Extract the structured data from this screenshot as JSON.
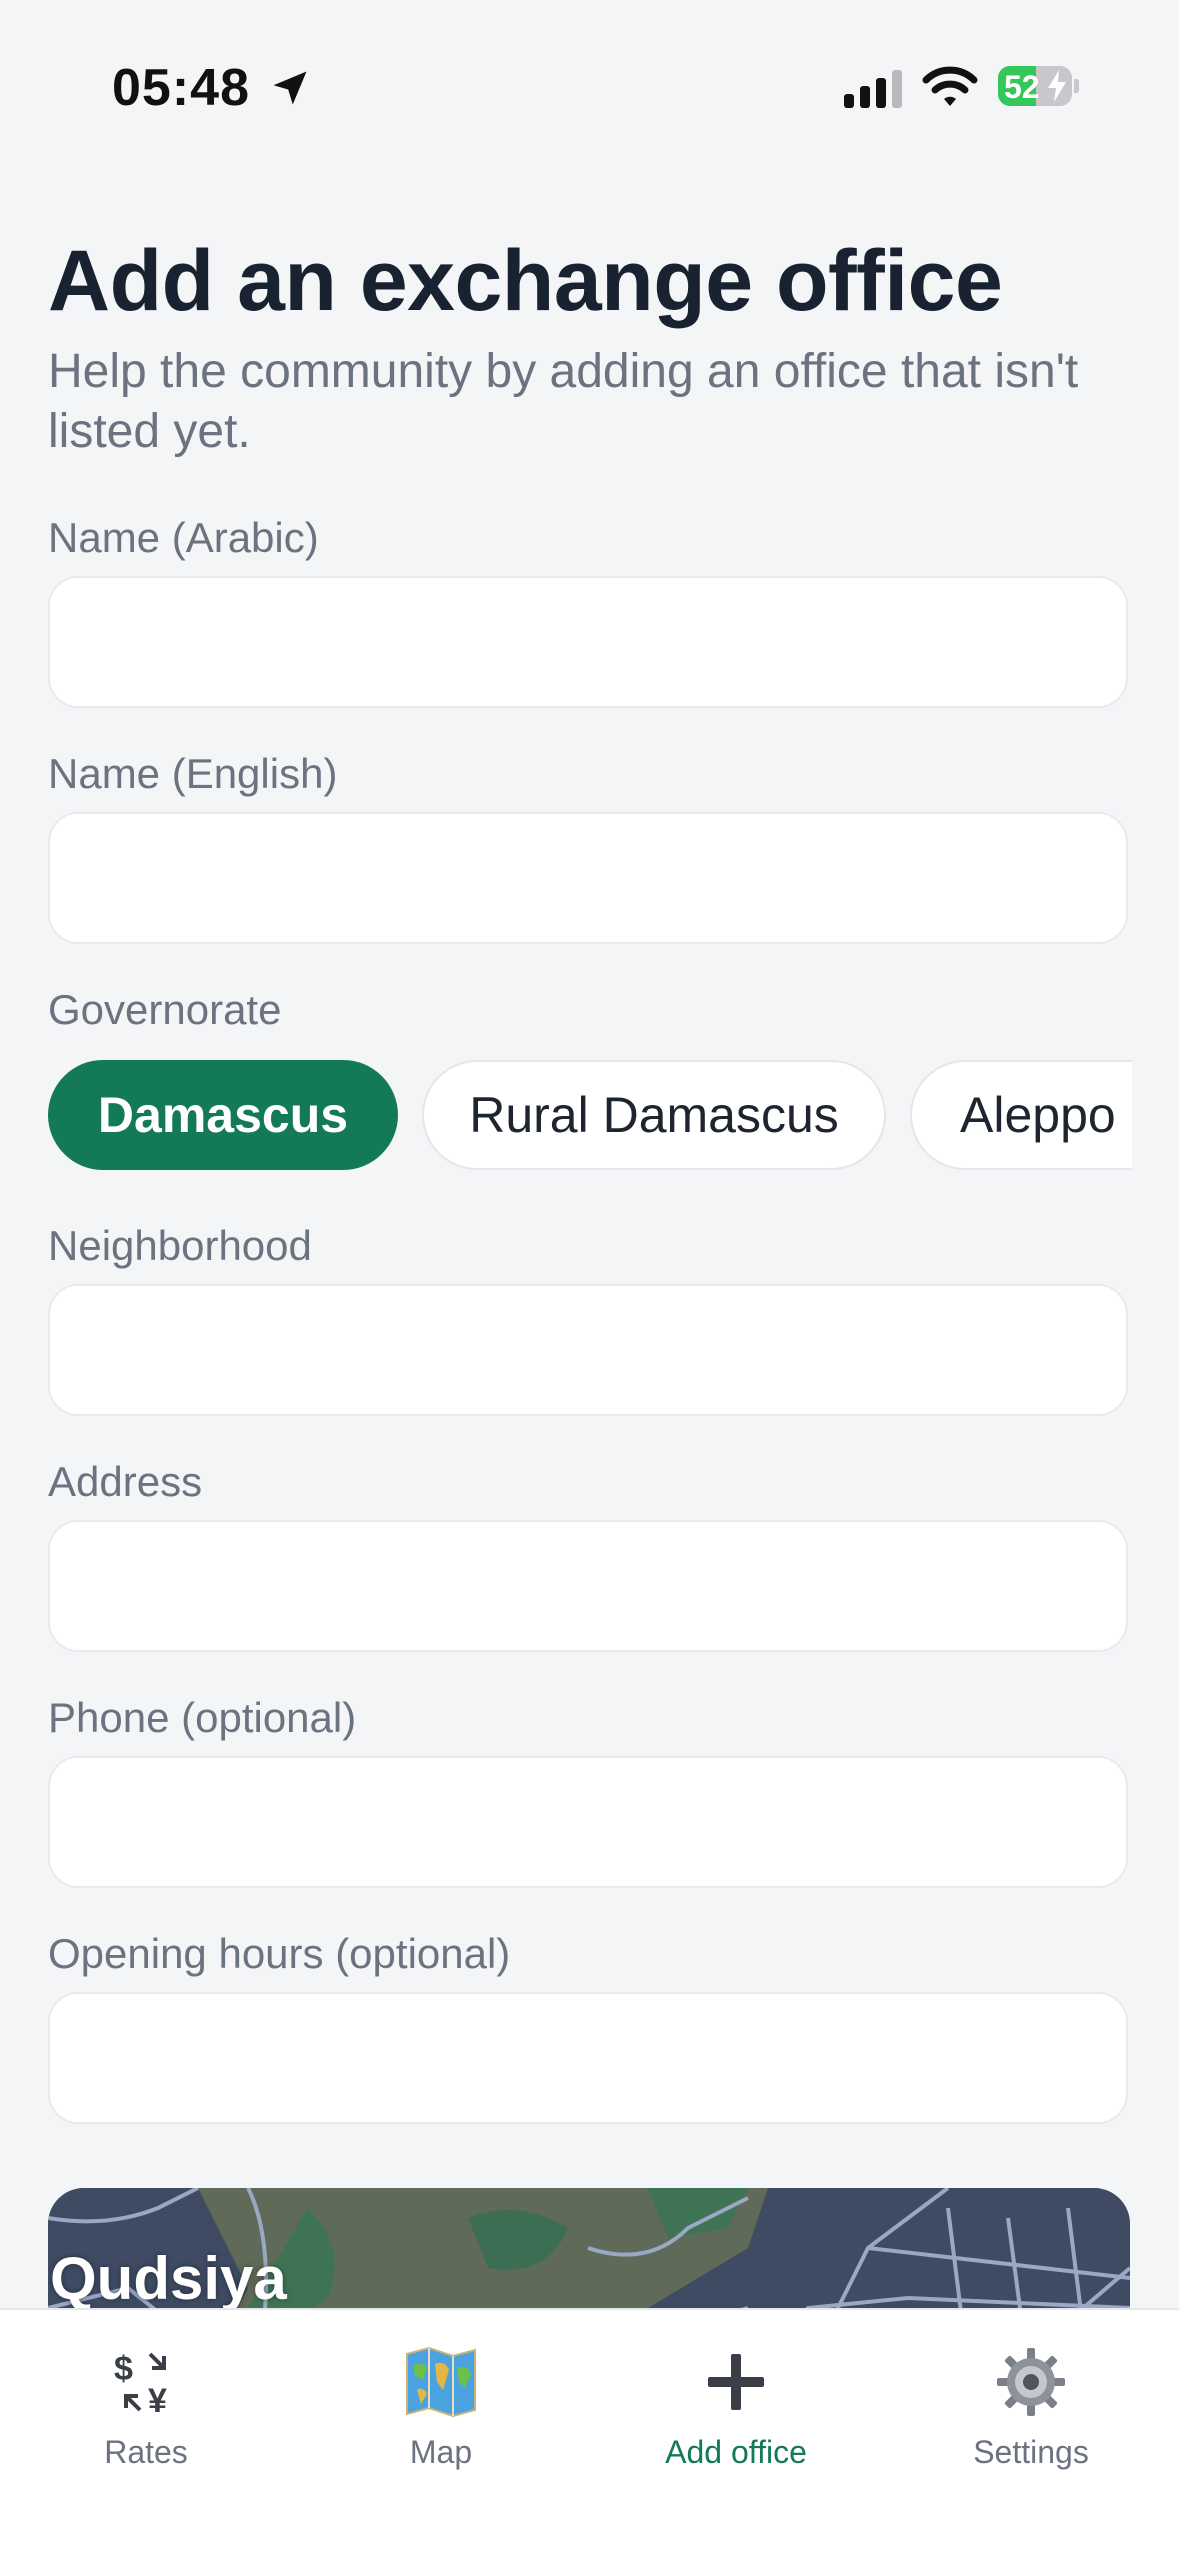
{
  "status_bar": {
    "time": "05:48",
    "battery_level": "52",
    "battery_fraction": 0.52
  },
  "header": {
    "title": "Add an exchange office",
    "subtitle": "Help the community by adding an office that isn't listed yet."
  },
  "form": {
    "name_ar_label": "Name (Arabic)",
    "name_en_label": "Name (English)",
    "governorate_label": "Governorate",
    "governorates": [
      "Damascus",
      "Rural Damascus",
      "Aleppo"
    ],
    "selected_governorate": "Damascus",
    "neighborhood_label": "Neighborhood",
    "address_label": "Address",
    "phone_label": "Phone (optional)",
    "hours_label": "Opening hours (optional)"
  },
  "map": {
    "place_label": "Qudsiya"
  },
  "tab_bar": {
    "tabs": [
      {
        "label": "Rates",
        "icon": "currency-exchange-icon"
      },
      {
        "label": "Map",
        "icon": "world-map-icon"
      },
      {
        "label": "Add office",
        "icon": "plus-icon"
      },
      {
        "label": "Settings",
        "icon": "gear-icon"
      }
    ],
    "active_tab": "Add office"
  },
  "colors": {
    "accent": "#137a55",
    "background": "#f4f5f7",
    "text_primary": "#182230",
    "text_secondary": "#6b7280"
  }
}
